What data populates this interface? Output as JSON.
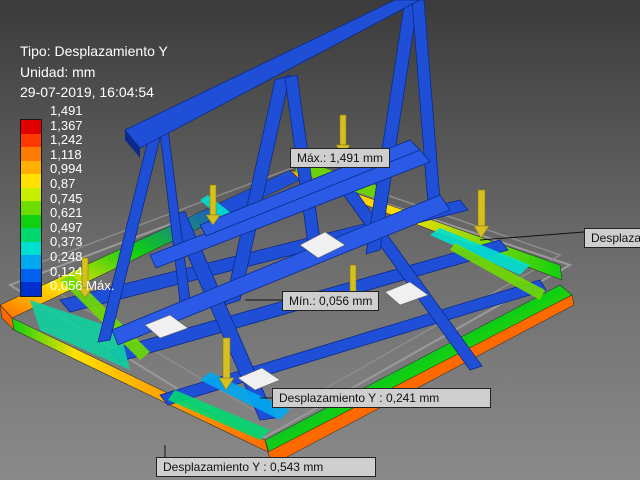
{
  "result_info": {
    "type_line": "Tipo: Desplazamiento Y",
    "unit_line": "Unidad: mm",
    "timestamp_line": "29-07-2019, 16:04:54"
  },
  "legend": {
    "ticks": [
      "1,491",
      "1,367",
      "1,242",
      "1,118",
      "0,994",
      "0,87",
      "0,745",
      "0,621",
      "0,497",
      "0,373",
      "0,248",
      "0,124",
      "0,056 Máx."
    ],
    "colors": [
      "#e00000",
      "#ff3a00",
      "#ff7a00",
      "#ffb000",
      "#ffe000",
      "#c8ef00",
      "#6fdc00",
      "#10d010",
      "#00d870",
      "#00e0d0",
      "#00a8f0",
      "#0060f0",
      "#0030d0"
    ]
  },
  "probes": {
    "max": "Máx.: 1,491 mm",
    "min": "Mín.: 0,056 mm",
    "right": "Desplazamiento Y",
    "center": "Desplazamiento Y : 0,241 mm",
    "bottom": "Desplazamiento Y : 0,543 mm"
  },
  "colors": {
    "frame_blue": "#1f4fd6",
    "frame_dark": "#0c2a8a",
    "hot_orange": "#ff6a00",
    "load_arrow": "#d6c020",
    "background": "#6e6e6e"
  }
}
